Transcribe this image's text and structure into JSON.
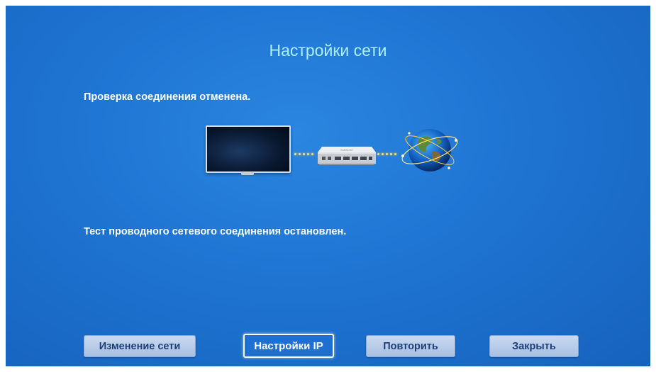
{
  "header": {
    "title": "Настройки сети"
  },
  "messages": {
    "connection_check": "Проверка соединения отменена.",
    "wired_test": "Тест проводного сетевого соединения остановлен."
  },
  "diagram": {
    "router_brand": "SAMSUNG",
    "link_color": "#ffe27a"
  },
  "buttons": {
    "change_network": "Изменение сети",
    "ip_settings": "Настройки IP",
    "retry": "Повторить",
    "close": "Закрыть"
  },
  "colors": {
    "background": "#1f74d2",
    "title": "#aef0ff",
    "button_text": "#1d3f78",
    "focused_button": "#1e6fd0"
  }
}
